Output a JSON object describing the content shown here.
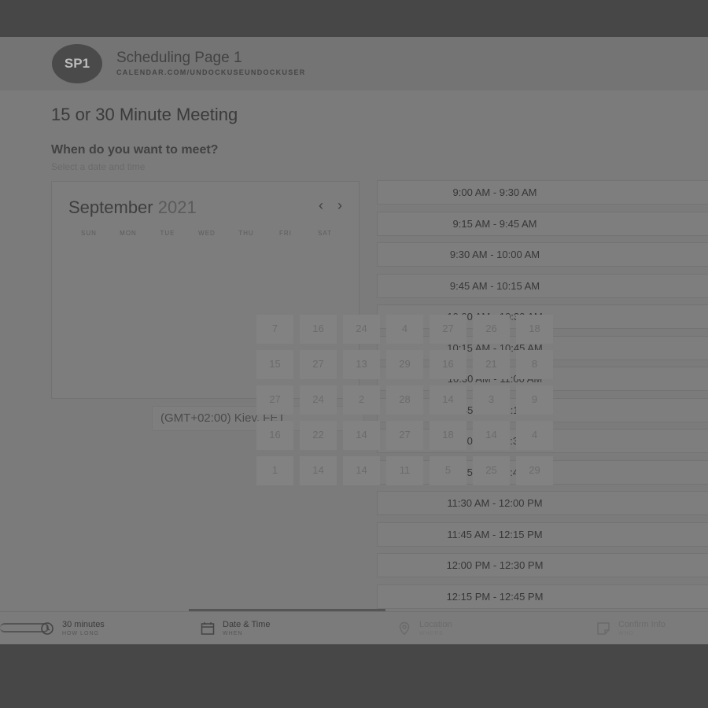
{
  "header": {
    "avatar_initials": "SP1",
    "page_name": "Scheduling Page 1",
    "page_url": "CALENDAR.COM/UNDOCKUSEUNDOCKUSER"
  },
  "meeting_title": "15 or 30 Minute Meeting",
  "question": "When do you want to meet?",
  "hint": "Select a date and time",
  "calendar": {
    "month": "September",
    "year": "2021",
    "prev_glyph": "‹",
    "next_glyph": "›",
    "weekdays": [
      "SUN",
      "MON",
      "TUE",
      "WED",
      "THU",
      "FRI",
      "SAT"
    ],
    "date_cells": [
      [
        "7",
        "16",
        "24",
        "4",
        "27",
        "26",
        "18"
      ],
      [
        "15",
        "27",
        "13",
        "29",
        "16",
        "21",
        "8"
      ],
      [
        "27",
        "24",
        "2",
        "28",
        "14",
        "3",
        "9"
      ],
      [
        "16",
        "22",
        "14",
        "27",
        "18",
        "14",
        "4"
      ],
      [
        "1",
        "14",
        "14",
        "11",
        "5",
        "25",
        "29"
      ]
    ]
  },
  "timezone": "(GMT+02:00) Kiev, FET",
  "time_slots": [
    "9:00 AM - 9:30 AM",
    "9:15 AM - 9:45 AM",
    "9:30 AM - 10:00 AM",
    "9:45 AM - 10:15 AM",
    "10:00 AM - 10:30 AM",
    "10:15 AM - 10:45 AM",
    "10:30 AM - 11:00 AM",
    "10:45 AM - 11:15 AM",
    "11:00 AM - 11:30 AM",
    "11:15 AM - 11:45 AM",
    "11:30 AM - 12:00 PM",
    "11:45 AM - 12:15 PM",
    "12:00 PM - 12:30 PM",
    "12:15 PM - 12:45 PM"
  ],
  "steps": [
    {
      "label": "30 minutes",
      "sub": "HOW LONG",
      "icon": "clock-icon"
    },
    {
      "label": "Date & Time",
      "sub": "WHEN",
      "icon": "calendar-icon"
    },
    {
      "label": "Location",
      "sub": "WHERE",
      "icon": "location-pin-icon"
    },
    {
      "label": "Confirm Info",
      "sub": "WHO",
      "icon": "note-icon"
    }
  ]
}
